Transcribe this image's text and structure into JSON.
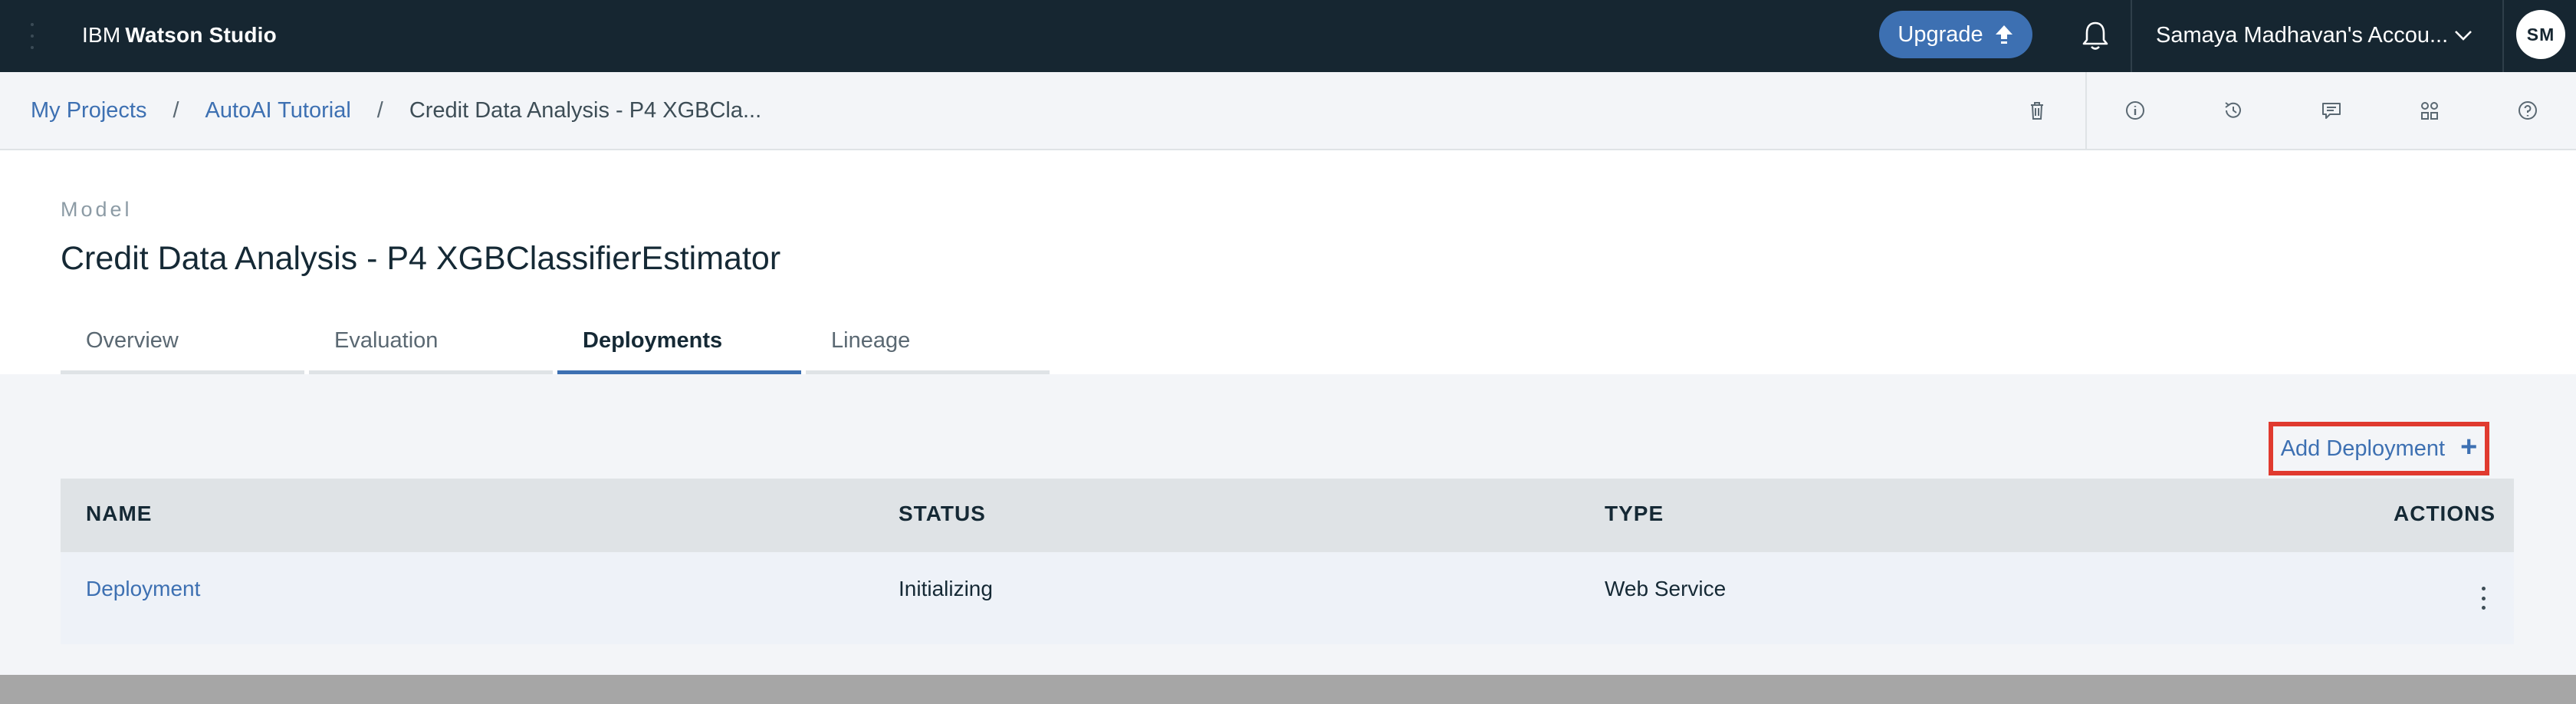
{
  "topbar": {
    "brand_prefix": "IBM",
    "brand_name": "Watson Studio",
    "upgrade_label": "Upgrade",
    "account_label": "Samaya Madhavan's Accou...",
    "avatar_initials": "SM"
  },
  "breadcrumb": {
    "items": [
      "My Projects",
      "AutoAI Tutorial"
    ],
    "separator": "/",
    "current": "Credit Data Analysis - P4 XGBCla..."
  },
  "toolbar": {
    "icons": [
      "trash-icon",
      "info-icon",
      "history-icon",
      "comment-icon",
      "assets-icon",
      "help-icon"
    ]
  },
  "header": {
    "eyebrow": "Model",
    "title": "Credit Data Analysis - P4 XGBClassifierEstimator"
  },
  "tabs": [
    {
      "label": "Overview",
      "active": false
    },
    {
      "label": "Evaluation",
      "active": false
    },
    {
      "label": "Deployments",
      "active": true
    },
    {
      "label": "Lineage",
      "active": false
    }
  ],
  "deployments": {
    "add_label": "Add Deployment",
    "add_symbol": "+",
    "columns": [
      "NAME",
      "STATUS",
      "TYPE",
      "ACTIONS"
    ],
    "rows": [
      {
        "name": "Deployment",
        "status": "Initializing",
        "type": "Web Service"
      }
    ]
  },
  "colors": {
    "topbar_bg": "#162631",
    "accent": "#3d70b2",
    "highlight_border": "#e03a2f"
  }
}
